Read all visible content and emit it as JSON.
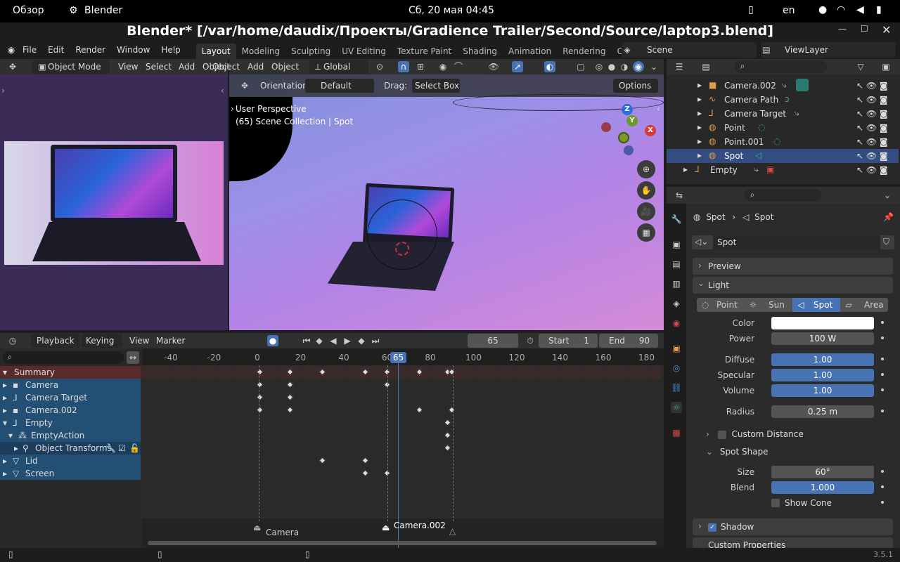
{
  "system": {
    "overview": "Обзор",
    "app": "Blender",
    "datetime": "Сб, 20 мая  04:45",
    "lang": "en"
  },
  "window": {
    "title": "Blender* [/var/home/daudix/Проекты/Gradience Trailer/Second/Source/laptop3.blend]"
  },
  "menus": [
    "File",
    "Edit",
    "Render",
    "Window",
    "Help"
  ],
  "workspaces": [
    "Layout",
    "Modeling",
    "Sculpting",
    "UV Editing",
    "Texture Paint",
    "Shading",
    "Animation",
    "Rendering",
    "Compositing"
  ],
  "scene": "Scene",
  "viewlayer": "ViewLayer",
  "viewport_header": {
    "mode": "Object Mode",
    "items": [
      "View",
      "Select",
      "Add",
      "Object"
    ],
    "obj2": "Object",
    "add2": "Add",
    "view2": "View",
    "select2": "Select",
    "orientation": "Global"
  },
  "tool_header": {
    "orientation_label": "Orientation:",
    "orientation": "Default",
    "drag_label": "Drag:",
    "drag": "Select Box",
    "options": "Options"
  },
  "viewport": {
    "perspective": "User Perspective",
    "collection": "(65) Scene Collection | Spot",
    "gizmo": {
      "z": "Z",
      "y": "Y",
      "x": "X"
    }
  },
  "outliner": [
    {
      "name": "Camera.002",
      "icon": "camera"
    },
    {
      "name": "Camera Path",
      "icon": "curve"
    },
    {
      "name": "Camera Target",
      "icon": "empty"
    },
    {
      "name": "Point",
      "icon": "light"
    },
    {
      "name": "Point.001",
      "icon": "light"
    },
    {
      "name": "Spot",
      "icon": "light",
      "selected": true
    },
    {
      "name": "Empty",
      "icon": "empty"
    }
  ],
  "timeline_header": {
    "playback": "Playback",
    "keying": "Keying",
    "view": "View",
    "marker": "Marker",
    "frame": "65",
    "start_label": "Start",
    "start": "1",
    "end_label": "End",
    "end": "90"
  },
  "timeline_ticks": [
    "-40",
    "-20",
    "0",
    "20",
    "40",
    "60",
    "80",
    "100",
    "120",
    "140",
    "160",
    "180"
  ],
  "current_frame": "65",
  "channels": [
    "Summary",
    "Camera",
    "Camera Target",
    "Camera.002",
    "Empty",
    "EmptyAction",
    "Object Transforms",
    "Lid",
    "Screen"
  ],
  "markers": [
    {
      "label": "Camera",
      "frame": 0
    },
    {
      "label": "Camera.002",
      "frame": 60
    }
  ],
  "properties": {
    "breadcrumb": [
      "Spot",
      "Spot"
    ],
    "datablock": "Spot",
    "sections": {
      "preview": "Preview",
      "light": "Light",
      "custom_distance": "Custom Distance",
      "spot_shape": "Spot Shape",
      "shadow": "Shadow",
      "custom_props": "Custom Properties"
    },
    "light_types": [
      "Point",
      "Sun",
      "Spot",
      "Area"
    ],
    "active_type": "Spot",
    "fields": {
      "color_label": "Color",
      "power_label": "Power",
      "power": "100 W",
      "diffuse_label": "Diffuse",
      "diffuse": "1.00",
      "specular_label": "Specular",
      "specular": "1.00",
      "volume_label": "Volume",
      "volume": "1.00",
      "radius_label": "Radius",
      "radius": "0.25 m",
      "size_label": "Size",
      "size": "60°",
      "blend_label": "Blend",
      "blend": "1.000",
      "show_cone": "Show Cone"
    }
  },
  "version": "3.5.1",
  "colors": {
    "accent": "#4772b3",
    "selected_row": "#334d80",
    "channel_blue": "#234f74",
    "summary": "#5a2b2b"
  }
}
